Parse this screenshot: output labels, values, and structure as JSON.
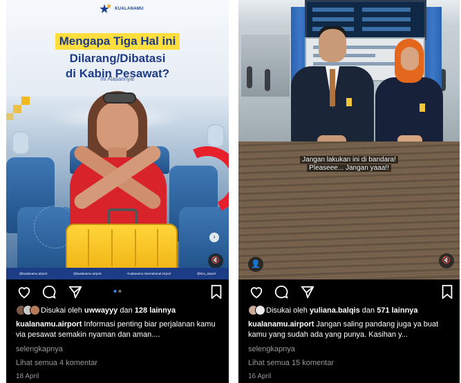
{
  "posts": [
    {
      "brand_logo_text": "KUALANAMU",
      "headline_line1": "Mengapa Tiga Hal ini",
      "headline_line2": "Dilarang/Dibatasi",
      "headline_line3": "di Kabin Pesawat?",
      "subheadline": "Ini Alasannya!",
      "social_handles": [
        "@kualanamu.airport",
        "@kualanamu.airport",
        "Kualanamu International Airport",
        "@kno_airport"
      ],
      "carousel_count": 2,
      "carousel_active": 1,
      "liked_by_prefix": "Disukai oleh",
      "liked_by_user": "uwwayyy",
      "liked_by_suffix": "dan",
      "liked_by_count": "128 lainnya",
      "username": "kualanamu.airport",
      "caption": "Informasi penting biar perjalanan kamu via pesawat semakin nyaman dan aman....",
      "more_label": "selengkapnya",
      "comments_label": "Lihat semua 4 komentar",
      "date": "18 April"
    },
    {
      "subtitle_line1": "Jangan lakukan ini di bandara!",
      "subtitle_line2": "Pleaseee... Jangan yaaa!!",
      "liked_by_prefix": "Disukai oleh",
      "liked_by_user": "yuliana.balqis",
      "liked_by_suffix": "dan",
      "liked_by_count": "571 lainnya",
      "username": "kualanamu.airport",
      "caption": "Jangan saling pandang juga ya buat kamu yang sudah ada yang punya. Kasihan y...",
      "more_label": "selengkapnya",
      "comments_label": "Lihat semua 15 komentar",
      "date": "16 April"
    }
  ],
  "icons": {
    "like": "heart-icon",
    "comment": "comment-icon",
    "share": "send-icon",
    "save": "bookmark-icon",
    "mute": "muted-speaker-icon",
    "tagged": "user-icon"
  },
  "colors": {
    "background": "#000000",
    "text": "#ffffff",
    "muted_text": "#9a9a9a",
    "carousel_active": "#3b8cf5",
    "headline_highlight": "#ffde3d",
    "headline_text": "#1e3b86"
  }
}
